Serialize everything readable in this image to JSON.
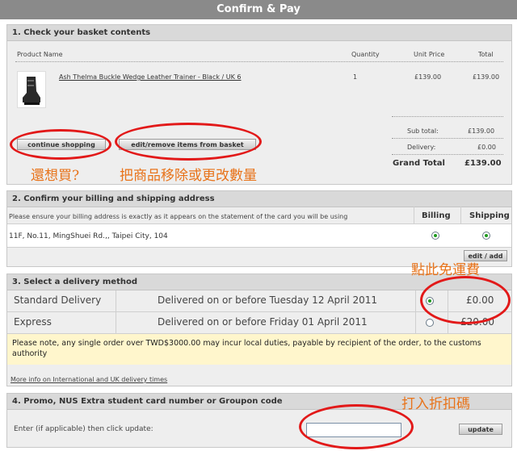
{
  "page": {
    "title": "Confirm & Pay"
  },
  "basket": {
    "heading": "1. Check your basket contents",
    "cols": {
      "name": "Product Name",
      "qty": "Quantity",
      "unit": "Unit Price",
      "total": "Total"
    },
    "item": {
      "name": "Ash Thelma Buckle Wedge Leather Trainer - Black / UK 6",
      "qty": "1",
      "unit": "£139.00",
      "total": "£139.00"
    },
    "subtotal_label": "Sub total:",
    "subtotal": "£139.00",
    "delivery_label": "Delivery:",
    "delivery": "£0.00",
    "grand_label": "Grand Total",
    "grand": "£139.00",
    "continue_label": "continue shopping",
    "edit_label": "edit/remove items from basket"
  },
  "address": {
    "heading": "2. Confirm your billing and shipping address",
    "note": "Please ensure your billing address is exactly as it appears on the statement of the card you will be using",
    "billing_label": "Billing",
    "shipping_label": "Shipping",
    "line": "11F, No.11, MingShuei Rd.,, Taipei City, 104",
    "edit_label": "edit / add"
  },
  "delivery": {
    "heading": "3. Select a delivery method",
    "options": [
      {
        "name": "Standard Delivery",
        "desc": "Delivered on or before Tuesday 12 April 2011",
        "price": "£0.00",
        "selected": true
      },
      {
        "name": "Express",
        "desc": "Delivered on or before Friday 01 April 2011",
        "price": "£20.00",
        "selected": false
      }
    ],
    "notice": "Please note, any single order over TWD$3000.00 may incur local duties, payable by recipient of the order, to the customs authority",
    "link": "More info on International and UK delivery times"
  },
  "promo": {
    "heading": "4. Promo, NUS Extra student card number or Groupon code",
    "label": "Enter (if applicable) then click update:",
    "value": "",
    "update_label": "update"
  },
  "annotations": {
    "buy_more": "還想買?",
    "remove_items": "把商品移除或更改數量",
    "free_shipping": "點此免運費",
    "enter_code": "打入折扣碼"
  },
  "colors": {
    "accent": "#e21919",
    "annotation": "#e8731a",
    "notice_bg": "#fff6cc",
    "selected_radio": "#1e9a1e"
  }
}
